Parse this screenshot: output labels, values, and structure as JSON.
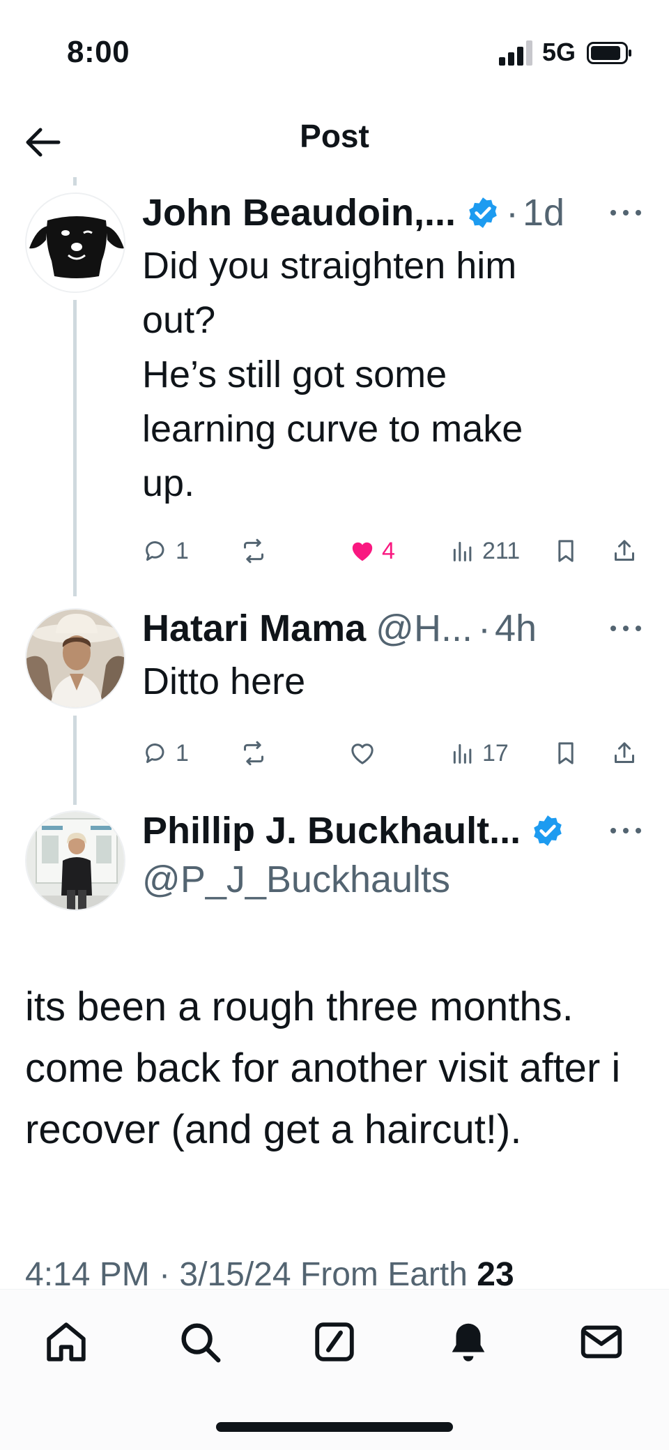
{
  "status_bar": {
    "time": "8:00",
    "network": "5G"
  },
  "header": {
    "title": "Post"
  },
  "tweets": [
    {
      "name": "John Beaudoin,...",
      "handle": "",
      "age": "1d",
      "verified": true,
      "text": "Did you straighten him\nout?\nHe’s still got some\nlearning curve to make\nup.",
      "replies": "1",
      "reposts": "",
      "likes": "4",
      "liked": true,
      "views": "211",
      "avatar_icon": "dog-face-avatar"
    },
    {
      "name": "Hatari Mama",
      "handle": "@H...",
      "age": "4h",
      "verified": false,
      "text": "Ditto here",
      "replies": "1",
      "reposts": "",
      "likes": "",
      "liked": false,
      "views": "17",
      "avatar_icon": "woman-in-hat-avatar"
    }
  ],
  "main_tweet": {
    "name": "Phillip J. Buckhault...",
    "handle": "@P_J_Buckhaults",
    "verified": true,
    "text": "its been a rough three months. come back for another visit after i recover (and get a haircut!).",
    "meta": "4:14 PM · 3/15/24 From Earth",
    "meta_count": "23",
    "avatar_icon": "man-at-poster-avatar"
  },
  "tab_bar": {
    "items": [
      "home-icon",
      "search-icon",
      "compose-icon",
      "notifications-icon",
      "messages-icon"
    ]
  },
  "colors": {
    "accent": "#1d9bf0",
    "like": "#f91880",
    "muted": "#536471",
    "text": "#0f1419"
  }
}
